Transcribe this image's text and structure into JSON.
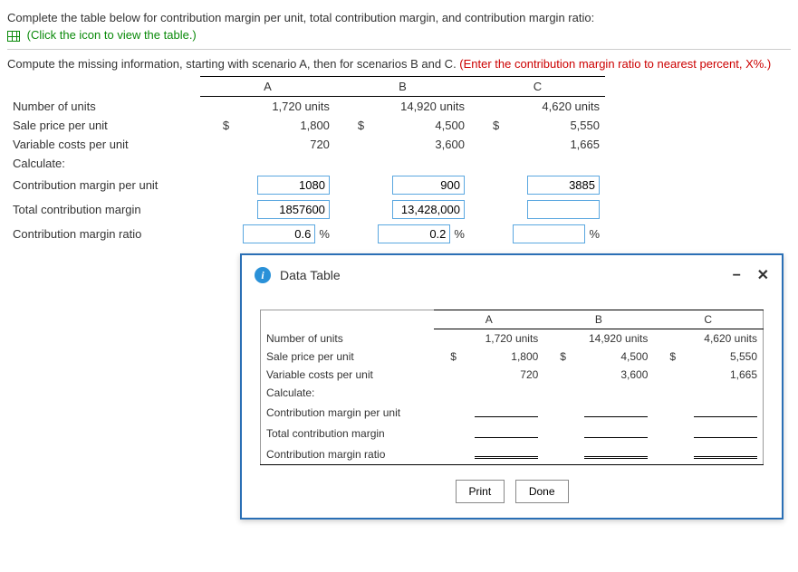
{
  "header": {
    "line1": "Complete the table below for contribution margin per unit, total contribution margin, and contribution margin ratio:",
    "link_text": "(Click the icon to view the table.)",
    "line2_prefix": "Compute the missing information, starting with scenario A, then for scenarios B and C. ",
    "line2_hint": "(Enter the contribution margin ratio to nearest percent, X%.)"
  },
  "cols": {
    "a": "A",
    "b": "B",
    "c": "C"
  },
  "rows": {
    "units_label": "Number of units",
    "sale_label": "Sale price per unit",
    "varcost_label": "Variable costs per unit",
    "calculate_label": "Calculate:",
    "cmpu_label": "Contribution margin per unit",
    "tcm_label": "Total contribution margin",
    "cmr_label": "Contribution margin ratio"
  },
  "given": {
    "units": {
      "a": "1,720 units",
      "b": "14,920 units",
      "c": "4,620 units"
    },
    "sale": {
      "a": "1,800",
      "b": "4,500",
      "c": "5,550"
    },
    "varcost": {
      "a": "720",
      "b": "3,600",
      "c": "1,665"
    }
  },
  "answers": {
    "cmpu": {
      "a": "1080",
      "b": "900",
      "c": "3885"
    },
    "tcm": {
      "a": "1857600",
      "b": "13,428,000",
      "c": ""
    },
    "cmr": {
      "a": "0.6",
      "b": "0.2",
      "c": ""
    }
  },
  "dollar": "$",
  "percent": "%",
  "modal": {
    "title": "Data Table",
    "print": "Print",
    "done": "Done",
    "info_glyph": "i",
    "minimize": "−",
    "close": "✕"
  }
}
